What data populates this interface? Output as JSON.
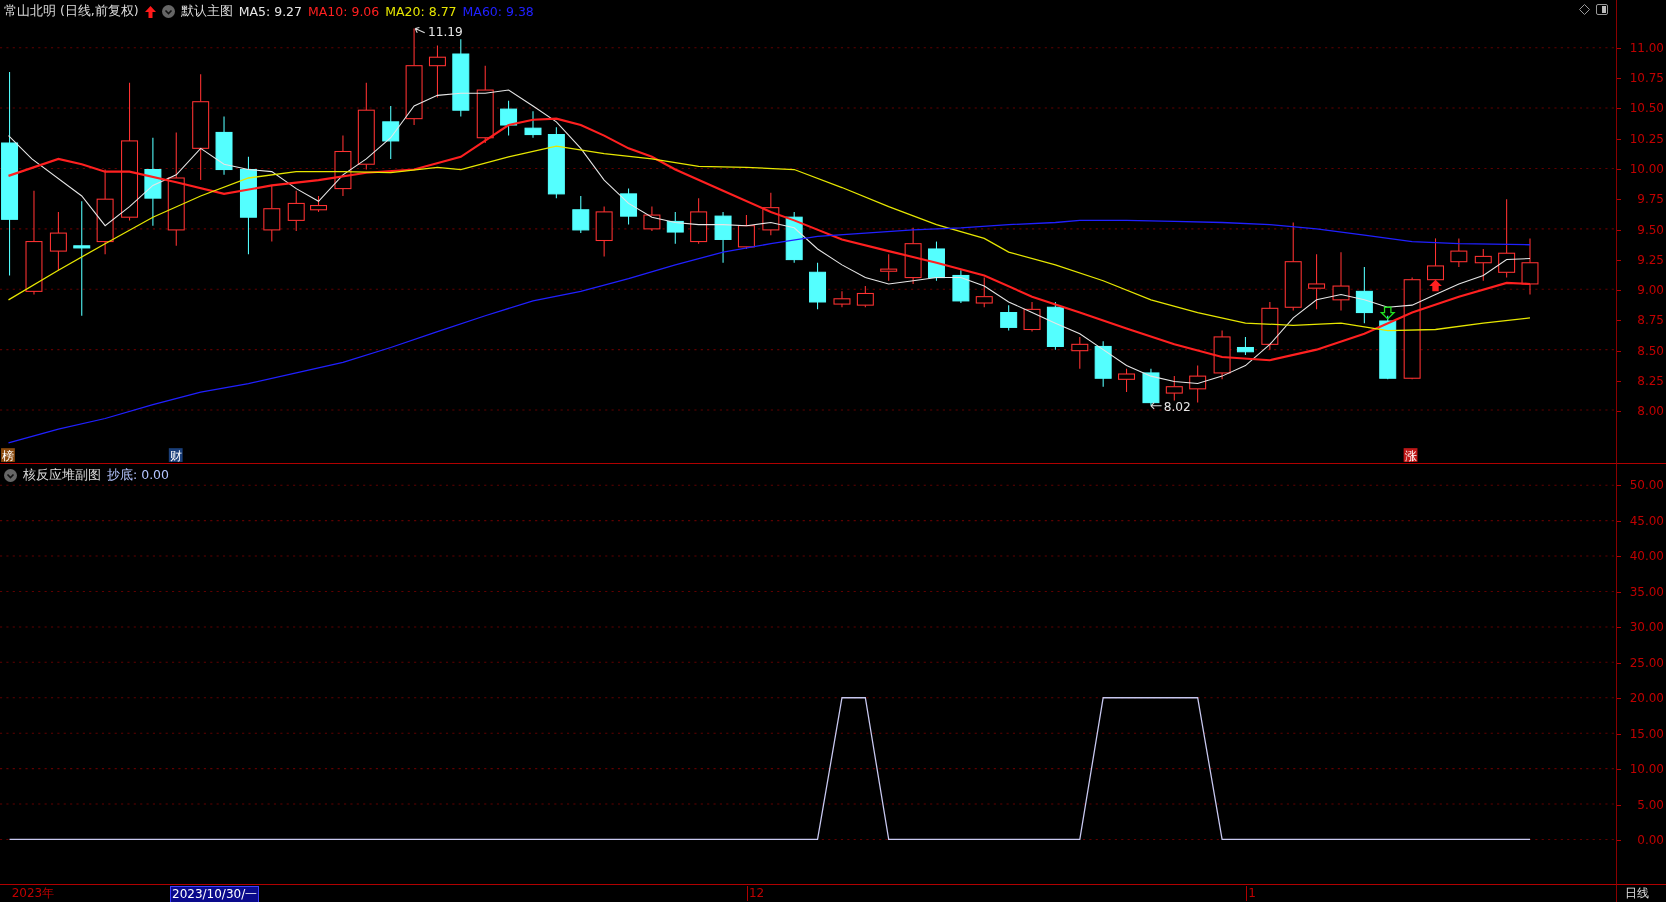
{
  "main_chart": {
    "title": "常山北明 (日线,前复权)",
    "template": "默认主图",
    "indicators": [
      {
        "label": "MA5: 9.27",
        "color": "#e6e6e6"
      },
      {
        "label": "MA10: 9.06",
        "color": "#ff2020"
      },
      {
        "label": "MA20: 8.77",
        "color": "#e6e600"
      },
      {
        "label": "MA60: 9.38",
        "color": "#2020ff"
      }
    ],
    "high_label": "11.19",
    "low_label": "8.02",
    "markers": [
      {
        "text": "榜",
        "color": "#8b4a0c"
      },
      {
        "text": "财",
        "color": "#1a3f7a"
      },
      {
        "text": "涨",
        "color": "#c01818"
      }
    ],
    "price_axis": [
      "11.00",
      "10.75",
      "10.50",
      "10.25",
      "10.00",
      "9.75",
      "9.50",
      "9.25",
      "9.00",
      "8.75",
      "8.50",
      "8.25",
      "8.00"
    ]
  },
  "sub_chart": {
    "title": "核反应堆副图",
    "reading": "抄底: 0.00",
    "chart_data": {
      "type": "line",
      "grid": true,
      "ylim": [
        0,
        50
      ],
      "yticks": [
        {
          "value": 50,
          "label": "50.00"
        },
        {
          "value": 45,
          "label": "45.00"
        },
        {
          "value": 40,
          "label": "40.00"
        },
        {
          "value": 35,
          "label": "35.00"
        },
        {
          "value": 30,
          "label": "30.00"
        },
        {
          "value": 25,
          "label": "25.00"
        },
        {
          "value": 20,
          "label": "20.00"
        },
        {
          "value": 15,
          "label": "15.00"
        },
        {
          "value": 10,
          "label": "10.00"
        },
        {
          "value": 5,
          "label": "5.00"
        },
        {
          "value": 0,
          "label": "0.00"
        }
      ],
      "series": [
        {
          "color": "#c8c8f0",
          "values": [
            0,
            0,
            0,
            0,
            0,
            0,
            0,
            0,
            0,
            0,
            0,
            0,
            0,
            0,
            0,
            0,
            0,
            0,
            0,
            0,
            0,
            0,
            0,
            0,
            0,
            0,
            0,
            0,
            0,
            0,
            0,
            0,
            0,
            0,
            0,
            20,
            20,
            0,
            0,
            0,
            0,
            0,
            0,
            0,
            0,
            0,
            20,
            20,
            20,
            20,
            20,
            0,
            0,
            0,
            0,
            0,
            0,
            0,
            0,
            0,
            0,
            0,
            0,
            0,
            0
          ]
        }
      ]
    }
  },
  "time_axis": [
    {
      "text": "2023年",
      "kind": "year"
    },
    {
      "text": "2023/10/30/一",
      "kind": "cursor"
    },
    {
      "text": "12",
      "kind": "month"
    },
    {
      "text": "1",
      "kind": "month"
    }
  ],
  "period": "日线"
}
